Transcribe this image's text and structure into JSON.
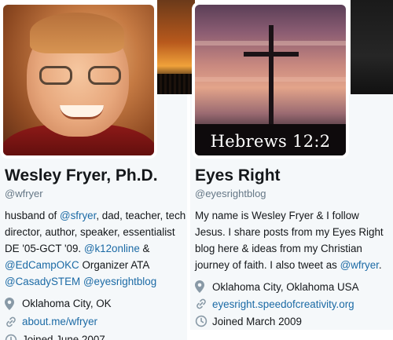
{
  "profiles": [
    {
      "name": "Wesley Fryer, Ph.D.",
      "handle": "@wfryer",
      "bio": {
        "l1a": "husband of ",
        "l1link": "@sfryer",
        "l1b": ", dad, teacher, tech",
        "l2": "director, author, speaker, essentialist",
        "l3a": "DE '05-GCT '09. ",
        "l3link": "@k12online",
        "l3b": " &",
        "l4link": "@EdCampOKC",
        "l4b": " Organizer ATA",
        "l5link1": "@CasadySTEM",
        "l5link2": "@eyesrightblog"
      },
      "location": "Oklahoma City, OK",
      "website": "about.me/wfryer",
      "joined": "Joined June 2007",
      "icons": {
        "location": "pin-icon",
        "website": "link-icon",
        "joined": "calendar-icon"
      }
    },
    {
      "name": "Eyes Right",
      "handle": "@eyesrightblog",
      "bio": {
        "l1": "My name is Wesley Fryer & I follow",
        "l2": "Jesus. I share posts from my Eyes Right",
        "l3": "blog here & ideas from my Christian",
        "l4a": "journey of faith. I also tweet as ",
        "l4link": "@wfryer",
        "l4b": "."
      },
      "location": "Oklahoma City, Oklahoma USA",
      "website": "eyesright.speedofcreativity.org",
      "joined": "Joined March 2009",
      "avatar_caption": "Hebrews 12:2",
      "icons": {
        "location": "pin-icon",
        "website": "link-icon",
        "joined": "calendar-icon"
      }
    }
  ],
  "colors": {
    "link": "#1b6aa5",
    "muted": "#657786",
    "panel": "#f5f8fa"
  }
}
